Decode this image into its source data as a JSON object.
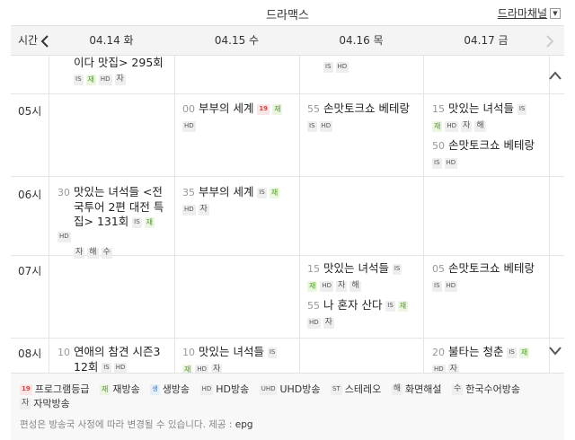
{
  "topbar": {
    "channel_title": "드라맥스",
    "channel_select_label": "드라마채널"
  },
  "header": {
    "time_label": "시간",
    "days": [
      "04.14 화",
      "04.15 수",
      "04.16 목",
      "04.17 금"
    ]
  },
  "hours": [
    "05시",
    "06시",
    "07시",
    "08시"
  ],
  "programs": {
    "d1_0": {
      "title": "이다 맛집> 295회",
      "badges": [
        "IS",
        "재",
        "HD",
        "자"
      ]
    },
    "d3_0": {
      "badges": [
        "IS",
        "HD"
      ]
    },
    "d2_05": {
      "minute": "00",
      "title": "부부의 세계",
      "badges": [
        "19",
        "재",
        "HD"
      ]
    },
    "d3_05": {
      "minute": "55",
      "title": "손맛토크쇼 베테랑",
      "badges": [
        "IS",
        "HD"
      ]
    },
    "d4_05a": {
      "minute": "15",
      "title": "맛있는 녀석들",
      "badges": [
        "IS",
        "재",
        "HD",
        "자",
        "해"
      ]
    },
    "d4_05b": {
      "minute": "50",
      "title": "손맛토크쇼 베테랑",
      "badges": [
        "IS",
        "HD"
      ]
    },
    "d1_06": {
      "minute": "30",
      "title_l1": "맛있는 녀석들 <전",
      "title_l2": "국투어 2편 대전 특",
      "title_l3": "집> 131회",
      "badges_inline": [
        "IS",
        "재",
        "HD"
      ],
      "badges": [
        "자",
        "해",
        "수"
      ]
    },
    "d2_06": {
      "minute": "35",
      "title": "부부의 세계",
      "badges_inline": [
        "IS",
        "재"
      ],
      "badges": [
        "HD",
        "자"
      ]
    },
    "d3_07a": {
      "minute": "15",
      "title": "맛있는 녀석들",
      "badges_inline": [
        "IS"
      ],
      "badges": [
        "재",
        "HD",
        "자",
        "해"
      ]
    },
    "d3_07b": {
      "minute": "55",
      "title": "나 혼자 산다",
      "badges_inline": [
        "IS",
        "재"
      ],
      "badges": [
        "HD",
        "자"
      ]
    },
    "d4_07": {
      "minute": "05",
      "title": "손맛토크쇼 베테랑",
      "badges_inline": [
        "IS"
      ],
      "badges": [
        "IS",
        "HD"
      ]
    },
    "d1_08": {
      "minute": "10",
      "title_l1": "연애의 참견 시즌3",
      "title_l2": "12회",
      "badges_inline": [
        "IS",
        "HD"
      ]
    },
    "d2_08": {
      "minute": "10",
      "title": "맛있는 녀석들",
      "badges_inline": [
        "IS"
      ],
      "badges": [
        "재",
        "HD",
        "자"
      ]
    },
    "d4_08": {
      "minute": "20",
      "title": "불타는 청춘",
      "badges_inline": [
        "IS",
        "재"
      ],
      "badges": [
        "HD",
        "자"
      ]
    }
  },
  "legend": {
    "items": [
      {
        "badge": "19",
        "label": "프로그램등급"
      },
      {
        "badge": "재",
        "label": "재방송"
      },
      {
        "badge": "생",
        "label": "생방송"
      },
      {
        "badge": "HD",
        "label": "HD방송"
      },
      {
        "badge": "UHD",
        "label": "UHD방송"
      },
      {
        "badge": "ST",
        "label": "스테레오"
      },
      {
        "badge": "해",
        "label": "화면해설"
      },
      {
        "badge": "수",
        "label": "한국수어방송"
      },
      {
        "badge": "자",
        "label": "자막방송"
      }
    ],
    "notice": "편성은 방송국 사정에 따라 변경될 수 있습니다. 제공 :",
    "provider": "epg"
  },
  "colors": {
    "rerun": "#4a9a1e",
    "age": "#d24646",
    "live": "#3a78c4"
  }
}
